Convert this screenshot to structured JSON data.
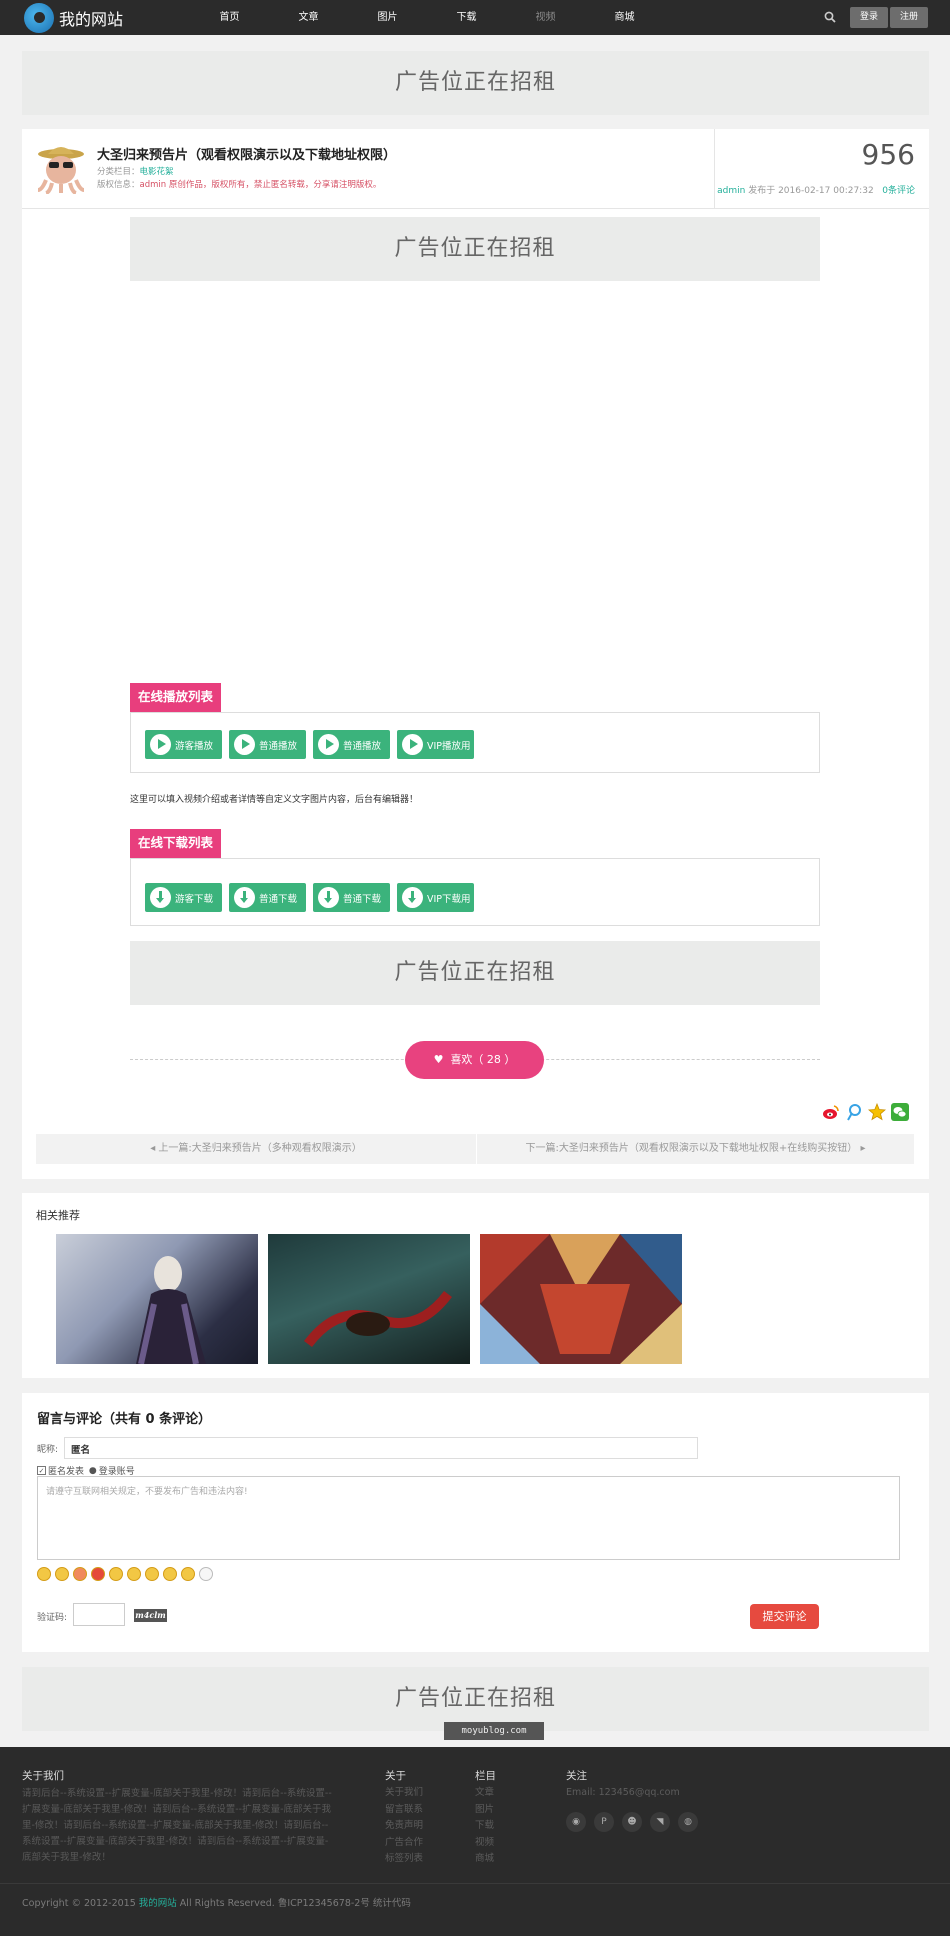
{
  "header": {
    "site_name": "我的网站",
    "nav": [
      "首页",
      "文章",
      "图片",
      "下载",
      "视频",
      "商城"
    ],
    "login": "登录",
    "register": "注册"
  },
  "ads": {
    "text": "广告位正在招租"
  },
  "post": {
    "title": "大圣归来预告片（观看权限演示以及下载地址权限）",
    "category_label": "分类栏目：",
    "category": "电影花絮",
    "copyright_label": "版权信息：",
    "copyright_user": "admin",
    "copyright_text": "原创作品，版权所有，禁止匿名转载，分享请注明版权。",
    "views": "956",
    "author": "admin",
    "published": "发布于 2016-02-17 00:27:32",
    "comments_link": "0条评论"
  },
  "play": {
    "heading": "在线播放列表",
    "buttons": [
      "游客播放",
      "普通播放",
      "普通播放",
      "VIP播放用"
    ]
  },
  "intro": "这里可以填入视频介绍或者详情等自定义文字图片内容，后台有编辑器！",
  "download": {
    "heading": "在线下载列表",
    "buttons": [
      "游客下载",
      "普通下载",
      "普通下载",
      "VIP下载用"
    ]
  },
  "like": {
    "label": "喜欢（ 28 ）"
  },
  "prev_next": {
    "prev": "上一篇:大圣归来预告片（多种观看权限演示）",
    "next": "下一篇:大圣归来预告片（观看权限演示以及下载地址权限+在线购买按钮）"
  },
  "related": {
    "heading": "相关推荐"
  },
  "comments": {
    "heading": "留言与评论（共有 0 条评论）",
    "nickname_label": "昵称:",
    "nickname_value": "匿名",
    "anonymous_label": "匿名发表",
    "login_label": "登录账号",
    "textarea_placeholder": "请遵守互联网相关规定，不要发布广告和违法内容!",
    "captcha_label": "验证码:",
    "captcha_code": "m4clm",
    "submit": "提交评论"
  },
  "watermark": "moyublog.com",
  "footer": {
    "about_title": "关于我们",
    "about_text": "请到后台--系统设置--扩展变量-底部关于我里-修改！请到后台--系统设置--扩展变量-底部关于我里-修改！请到后台--系统设置--扩展变量-底部关于我里-修改！请到后台--系统设置--扩展变量-底部关于我里-修改！请到后台--系统设置--扩展变量-底部关于我里-修改！请到后台--系统设置--扩展变量-底部关于我里-修改！",
    "col1_title": "关于",
    "col1_links": [
      "关于我们",
      "留言联系",
      "免责声明",
      "广告合作",
      "标签列表"
    ],
    "col2_title": "栏目",
    "col2_links": [
      "文章",
      "图片",
      "下载",
      "视频",
      "商城"
    ],
    "col3_title": "关注",
    "email": "Email: 123456@qq.com",
    "copyright_prefix": "Copyright © 2012-2015 ",
    "copyright_site": "我的网站",
    "copyright_suffix": " All Rights Reserved. 鲁ICP12345678-2号 统计代码"
  },
  "colors": {
    "accent": "#e83e7d",
    "green": "#3bb37c",
    "teal": "#25b09b",
    "submit": "#e64a3f",
    "topbar": "#2b2b2b"
  }
}
